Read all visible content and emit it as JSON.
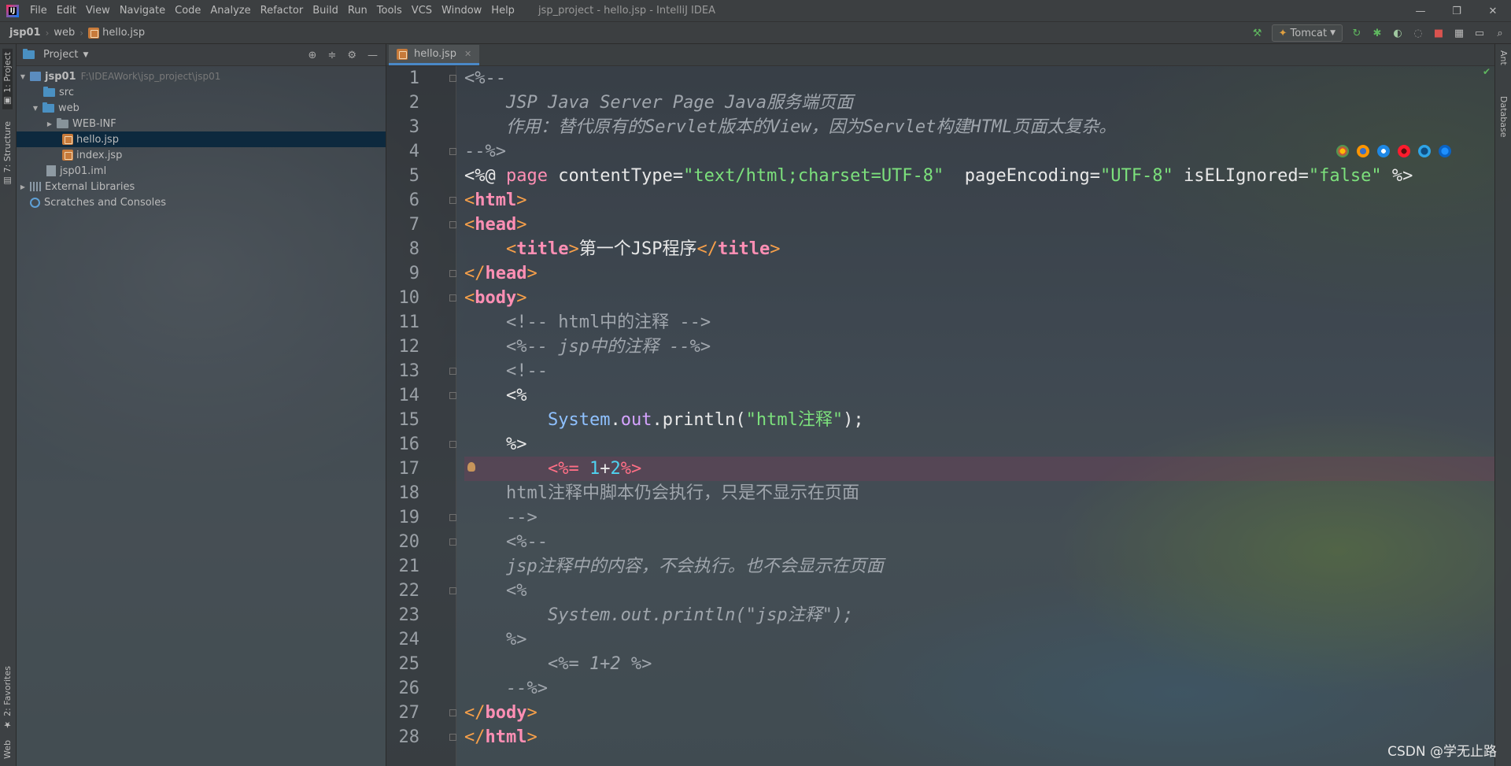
{
  "window": {
    "title": "jsp_project - hello.jsp - IntelliJ IDEA",
    "logo_text": "IJ",
    "minimize": "—",
    "restore": "❐",
    "close": "✕"
  },
  "menu": [
    "File",
    "Edit",
    "View",
    "Navigate",
    "Code",
    "Analyze",
    "Refactor",
    "Build",
    "Run",
    "Tools",
    "VCS",
    "Window",
    "Help"
  ],
  "breadcrumb": [
    "jsp01",
    "web",
    "hello.jsp"
  ],
  "run_config": {
    "label": "Tomcat"
  },
  "left_strip": {
    "project": "1: Project",
    "structure": "7: Structure",
    "favorites": "2: Favorites",
    "web": "Web"
  },
  "right_strip": {
    "ant": "Ant",
    "database": "Database"
  },
  "project_panel": {
    "title": "Project",
    "tree": [
      {
        "label": "jsp01",
        "hint": "F:\\IDEAWork\\jsp_project\\jsp01"
      },
      {
        "label": "src"
      },
      {
        "label": "web"
      },
      {
        "label": "WEB-INF"
      },
      {
        "label": "hello.jsp"
      },
      {
        "label": "index.jsp"
      },
      {
        "label": "jsp01.iml"
      },
      {
        "label": "External Libraries"
      },
      {
        "label": "Scratches and Consoles"
      }
    ]
  },
  "editor": {
    "tab": "hello.jsp",
    "line_numbers": [
      "1",
      "2",
      "3",
      "4",
      "5",
      "6",
      "7",
      "8",
      "9",
      "10",
      "11",
      "12",
      "13",
      "14",
      "15",
      "16",
      "17",
      "18",
      "19",
      "20",
      "21",
      "22",
      "23",
      "24",
      "25",
      "26",
      "27",
      "28"
    ],
    "lines": {
      "l1": "<%--",
      "l2": "    JSP Java Server Page Java服务端页面",
      "l3": "    作用：替代原有的Servlet版本的View，因为Servlet构建HTML页面太复杂。",
      "l4": "--%>",
      "l5_a": "<%@ ",
      "l5_b": "page",
      "l5_c": " contentType=",
      "l5_d": "\"text/html;charset=UTF-8\"",
      "l5_e": "  pageEncoding=",
      "l5_f": "\"UTF-8\"",
      "l5_g": " isELIgnored=",
      "l5_h": "\"false\"",
      "l5_i": " %>",
      "l6": "html",
      "l7": "head",
      "l8_text": "第一个JSP程序",
      "l8_tag": "title",
      "l9": "head",
      "l10": "body",
      "l11": "    <!-- html中的注释 -->",
      "l12": "    <%-- jsp中的注释 --%>",
      "l13": "    <!--",
      "l14": "    <%",
      "l15_a": "System",
      "l15_b": ".",
      "l15_c": "out",
      "l15_d": ".println(",
      "l15_e": "\"html注释\"",
      "l15_f": ");",
      "l16": "    %>",
      "l17_a": "<%=",
      "l17_b": "1",
      "l17_c": "+",
      "l17_d": "2",
      "l17_e": "%>",
      "l18": "    html注释中脚本仍会执行，只是不显示在页面",
      "l19": "    -->",
      "l20": "    <%--",
      "l21": "    jsp注释中的内容，不会执行。也不会显示在页面",
      "l22": "    <%",
      "l23": "        System.out.println(\"jsp注释\");",
      "l24": "    %>",
      "l25": "        <%= 1+2 %>",
      "l26": "    --%>",
      "l27": "body",
      "l28": "html"
    }
  },
  "watermark": "CSDN @学无止路"
}
